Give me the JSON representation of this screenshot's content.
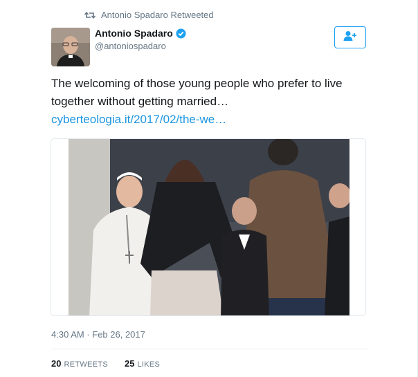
{
  "retweet_context": {
    "label": "Antonio Spadaro Retweeted",
    "icon": "retweet-icon"
  },
  "author": {
    "display_name": "Antonio Spadaro",
    "handle": "@antoniospadaro",
    "verified": true,
    "verified_icon": "verified-badge-icon"
  },
  "follow_button": {
    "icon": "follow-user-icon",
    "color": "#1da1f2"
  },
  "tweet": {
    "text": "The welcoming of those young people who prefer to live together without getting married… ",
    "link_text": "cyberteologia.it/2017/02/the-we…",
    "link_color": "#1b95e0"
  },
  "timestamp": "4:30 AM · Feb 26, 2017",
  "stats": {
    "retweets": {
      "count": "20",
      "label": "RETWEETS"
    },
    "likes": {
      "count": "25",
      "label": "LIKES"
    }
  }
}
